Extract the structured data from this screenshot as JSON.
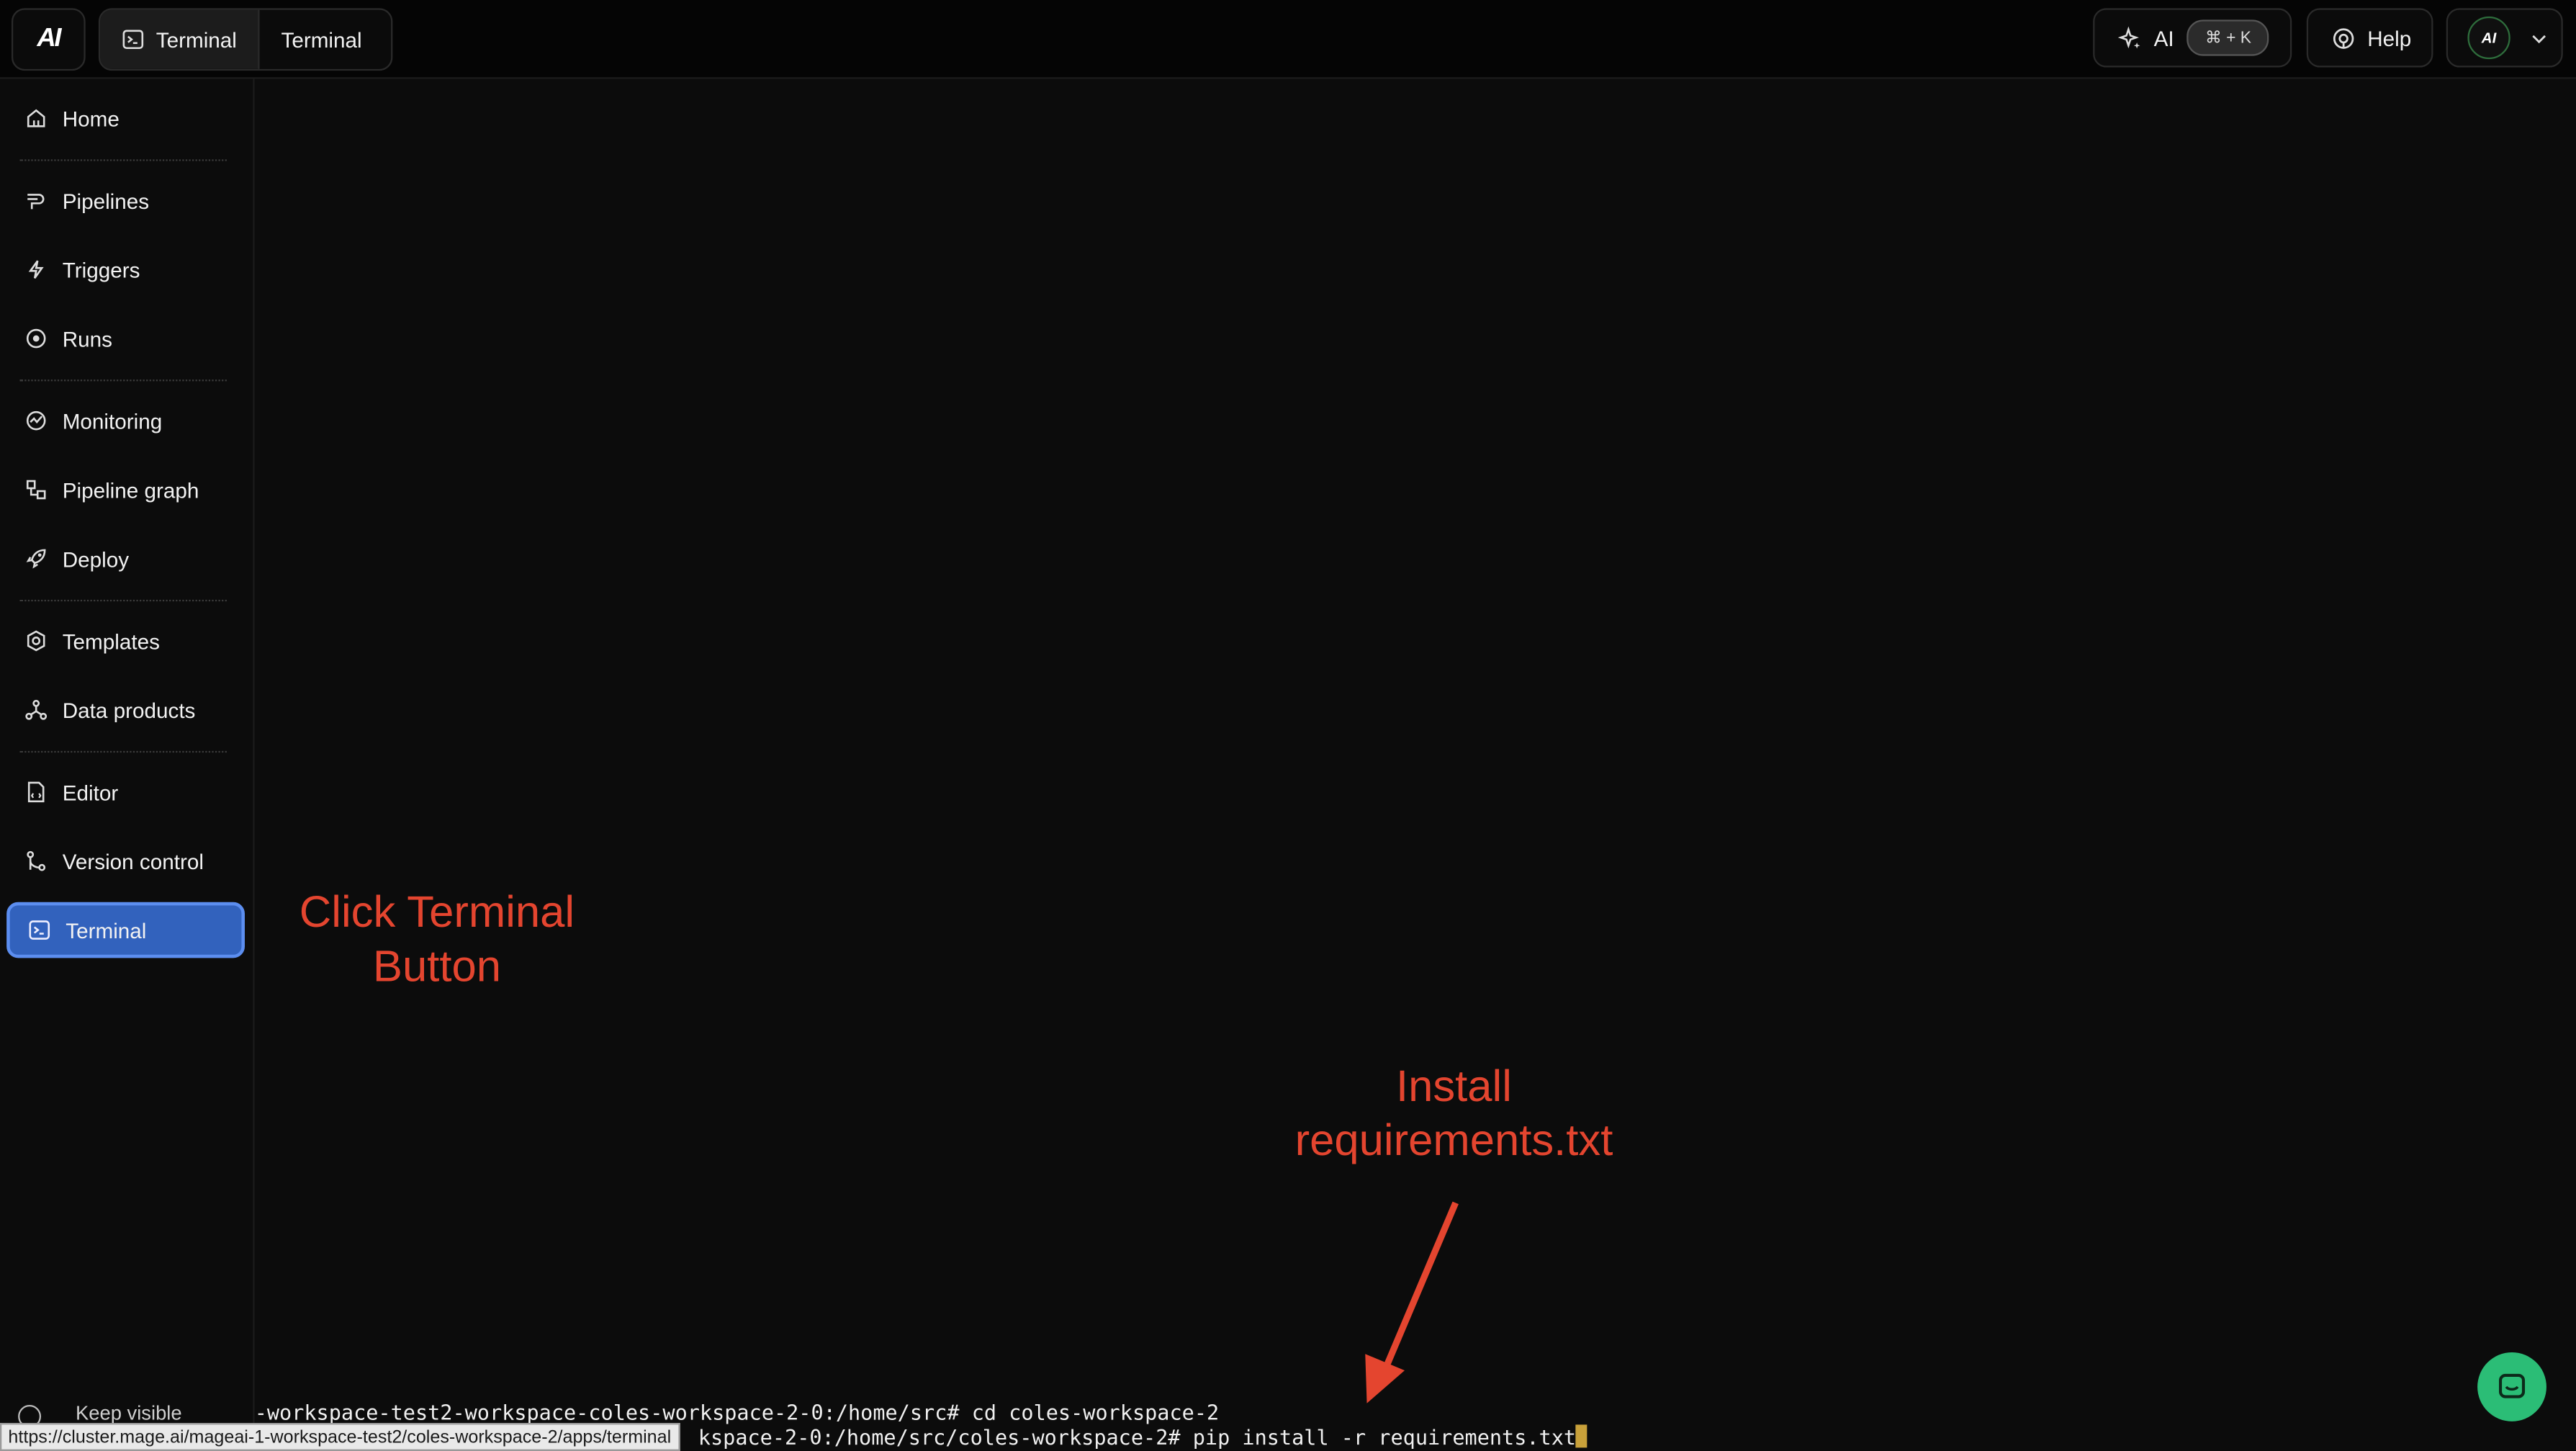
{
  "colors": {
    "accent": "#3262bd",
    "annotation": "#e4452f",
    "chat": "#2bbd76"
  },
  "header": {
    "logo": "AI",
    "tabs": [
      {
        "label": "Terminal",
        "icon": "terminal-icon"
      },
      {
        "label": "Terminal"
      }
    ],
    "ai_button": {
      "label": "AI",
      "shortcut": "⌘ + K",
      "icon": "sparkles-icon"
    },
    "help_button": {
      "label": "Help",
      "icon": "help-icon"
    },
    "user_avatar": "AI"
  },
  "sidebar": {
    "items": [
      {
        "label": "Home",
        "icon": "home-icon"
      },
      {
        "label": "Pipelines",
        "icon": "pipelines-icon"
      },
      {
        "label": "Triggers",
        "icon": "triggers-icon"
      },
      {
        "label": "Runs",
        "icon": "runs-icon"
      },
      {
        "label": "Monitoring",
        "icon": "monitoring-icon"
      },
      {
        "label": "Pipeline graph",
        "icon": "pipeline-graph-icon"
      },
      {
        "label": "Deploy",
        "icon": "rocket-icon"
      },
      {
        "label": "Templates",
        "icon": "templates-icon"
      },
      {
        "label": "Data products",
        "icon": "data-products-icon"
      },
      {
        "label": "Editor",
        "icon": "editor-icon"
      },
      {
        "label": "Version control",
        "icon": "version-control-icon"
      },
      {
        "label": "Terminal",
        "icon": "terminal-icon",
        "active": true
      }
    ],
    "keep_visible": "Keep visible"
  },
  "terminal": {
    "lines": [
      "-workspace-test2-workspace-coles-workspace-2-0:/home/src# cd coles-workspace-2",
      "kspace-2-0:/home/src/coles-workspace-2# pip install -r requirements.txt"
    ]
  },
  "status_url": "https://cluster.mage.ai/mageai-1-workspace-test2/coles-workspace-2/apps/terminal",
  "annotations": {
    "click_terminal": "Click Terminal\nButton",
    "install_requirements": "Install\nrequirements.txt"
  }
}
